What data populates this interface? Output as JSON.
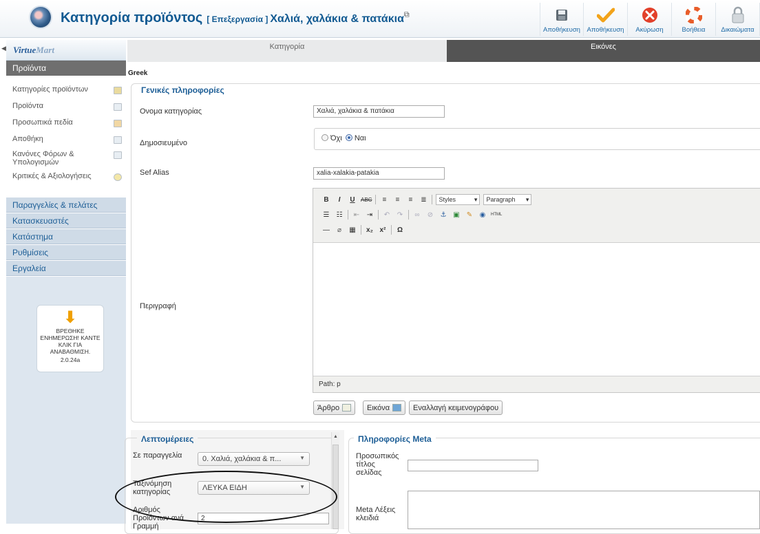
{
  "header": {
    "title": "Κατηγορία προϊόντος",
    "edit_tag": "[ Επεξεργασία ]",
    "item_name": "Χαλιά, χαλάκια & πατάκια",
    "toolbar": [
      {
        "label": "Αποθήκευση",
        "icon": "save-disk-icon"
      },
      {
        "label": "Αποθήκευση",
        "icon": "checkmark-icon"
      },
      {
        "label": "Ακύρωση",
        "icon": "cancel-icon"
      },
      {
        "label": "Βοήθεια",
        "icon": "help-lifebuoy-icon"
      },
      {
        "label": "Δικαιώματα",
        "icon": "lock-icon"
      }
    ]
  },
  "sidebar": {
    "brand": "VirtueMart",
    "active_section": "Προϊόντα",
    "items": [
      {
        "label": "Κατηγορίες προϊόντων"
      },
      {
        "label": "Προϊόντα"
      },
      {
        "label": "Προσωπικά πεδία"
      },
      {
        "label": "Αποθήκη"
      },
      {
        "label": "Κανόνες Φόρων & Υπολογισμών"
      },
      {
        "label": "Κριτικές & Αξιολογήσεις"
      }
    ],
    "groups": [
      "Παραγγελίες & πελάτες",
      "Κατασκευαστές",
      "Κατάστημα",
      "Ρυθμίσεις",
      "Εργαλεία"
    ],
    "update": {
      "text": "ΒΡΕΘΗΚΕ ΕΝΗΜΕΡΩΣΗ! ΚΑΝΤΕ ΚΛΙΚ ΓΙΑ ΑΝΑΒΑΘΜΙΣΗ.",
      "version": "2.0.24a"
    }
  },
  "tabs": {
    "category": "Κατηγορία",
    "images": "Εικόνες"
  },
  "language": "Greek",
  "general": {
    "legend": "Γενικές πληροφορίες",
    "name_label": "Ονομα κατηγορίας",
    "name_value": "Χαλιά, χαλάκια & πατάκια",
    "published_label": "Δημοσιευμένο",
    "no_label": "Όχι",
    "yes_label": "Ναι",
    "sef_label": "Sef Alias",
    "sef_value": "xalia-xalakia-patakia",
    "description_label": "Περιγραφή",
    "editor": {
      "styles": "Styles",
      "paragraph": "Paragraph",
      "path": "Path: p"
    },
    "buttons": {
      "article": "Άρθρο",
      "image": "Εικόνα",
      "toggle": "Εναλλαγή κειμενογράφου"
    }
  },
  "details": {
    "legend": "Λεπτομέρειες",
    "order_label": "Σε παραγγελία",
    "order_value": "0. Χαλιά, χαλάκια & π...",
    "sort_label": "Ταξινόμηση κατηγορίας",
    "sort_value": "ΛΕΥΚΑ ΕΙΔΗ",
    "per_row_label": "Αριθμός Προϊόντων ανά Γραμμή",
    "per_row_value": "2"
  },
  "meta": {
    "legend": "Πληροφορίες Meta",
    "title_label": "Προσωπικός τίτλος σελίδας",
    "keywords_label": "Meta Λέξεις κλειδιά"
  }
}
